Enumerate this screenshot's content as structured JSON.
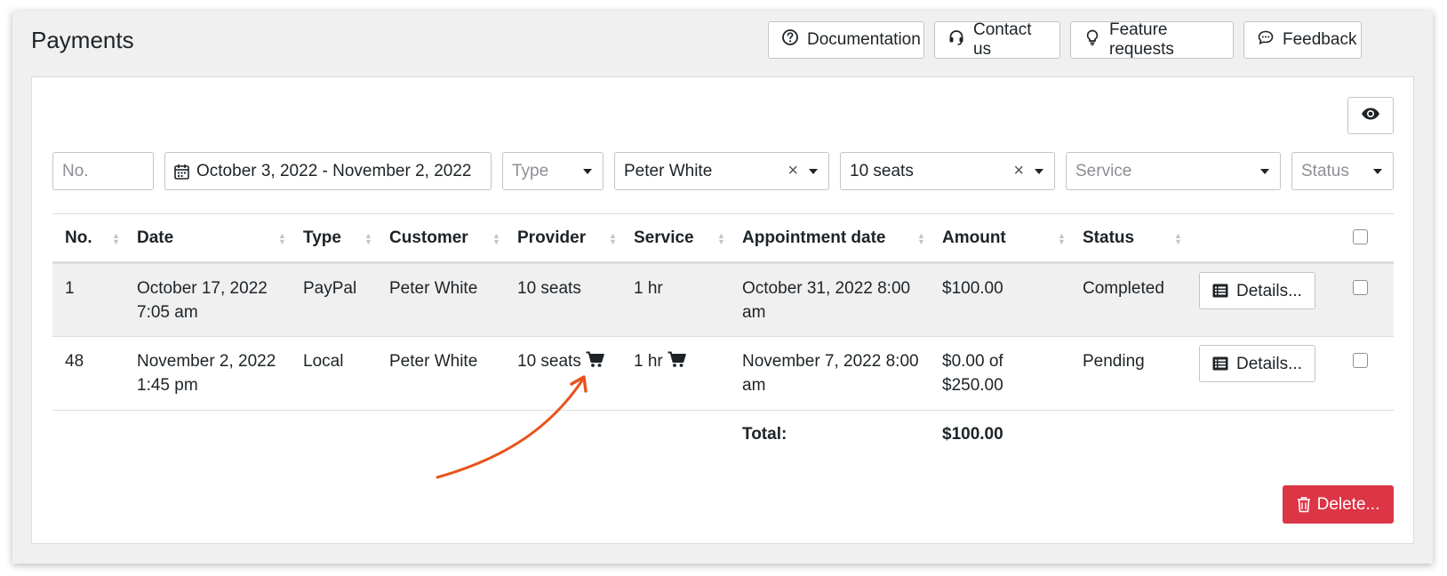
{
  "header": {
    "title": "Payments",
    "buttons": {
      "documentation": "Documentation",
      "contact": "Contact us",
      "feature_requests": "Feature requests",
      "feedback": "Feedback"
    }
  },
  "filters": {
    "no_placeholder": "No.",
    "date_range": "October 3, 2022 - November 2, 2022",
    "type_placeholder": "Type",
    "customer_value": "Peter White",
    "provider_value": "10 seats",
    "service_placeholder": "Service",
    "status_placeholder": "Status",
    "clear_symbol": "×"
  },
  "table": {
    "columns": [
      "No.",
      "Date",
      "Type",
      "Customer",
      "Provider",
      "Service",
      "Appointment date",
      "Amount",
      "Status"
    ],
    "rows": [
      {
        "no": "1",
        "date_line1": "October 17, 2022",
        "date_line2": "7:05 am",
        "type": "PayPal",
        "customer": "Peter White",
        "provider": "10 seats",
        "service": "1 hr",
        "appt_line1": "October 31, 2022 8:00",
        "appt_line2": "am",
        "amount_line1": "$100.00",
        "amount_line2": "",
        "status": "Completed",
        "action": "Details..."
      },
      {
        "no": "48",
        "date_line1": "November 2, 2022",
        "date_line2": "1:45 pm",
        "type": "Local",
        "customer": "Peter White",
        "provider": "10 seats",
        "service": "1 hr",
        "appt_line1": "November 7, 2022 8:00",
        "appt_line2": "am",
        "amount_line1": "$0.00 of",
        "amount_line2": "$250.00",
        "status": "Pending",
        "action": "Details..."
      }
    ],
    "total_label": "Total:",
    "total_value": "$100.00"
  },
  "footer": {
    "delete_label": "Delete..."
  },
  "colors": {
    "delete_bg": "#dc3545",
    "annotation_arrow": "#e8531a",
    "row_highlight": "#f0f0f1"
  },
  "icons": [
    "help-circle-icon",
    "headset-icon",
    "lightbulb-icon",
    "chat-bubble-icon",
    "eye-icon",
    "calendar-icon",
    "list-icon",
    "cart-icon",
    "trash-icon"
  ]
}
